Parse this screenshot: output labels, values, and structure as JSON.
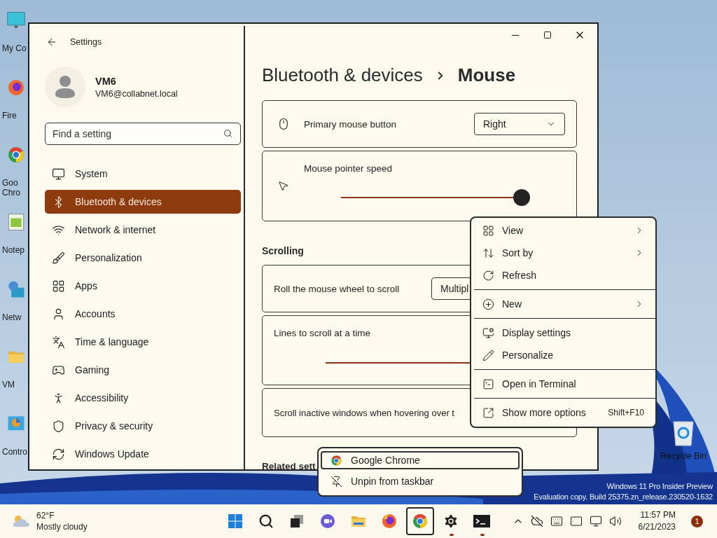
{
  "desktop": {
    "icons": [
      {
        "lines": [
          "My Co"
        ]
      },
      {
        "lines": [
          "Fire"
        ]
      },
      {
        "lines": [
          "Goo",
          "Chro"
        ]
      },
      {
        "lines": [
          "Notep"
        ]
      },
      {
        "lines": [
          "Netw"
        ]
      },
      {
        "lines": [
          "VM"
        ]
      },
      {
        "lines": [
          "Contro"
        ]
      }
    ],
    "recycle_bin": "Recycle Bin",
    "watermark": [
      "Windows 11 Pro Insider Preview",
      "Evaluation copy. Build 25375.zn_release.230520-1632"
    ]
  },
  "settings": {
    "title": "Settings",
    "user": {
      "name": "VM6",
      "email": "VM6@collabnet.local"
    },
    "search": {
      "placeholder": "Find a setting"
    },
    "nav": [
      {
        "label": "System",
        "selected": false
      },
      {
        "label": "Bluetooth & devices",
        "selected": true
      },
      {
        "label": "Network & internet",
        "selected": false
      },
      {
        "label": "Personalization",
        "selected": false
      },
      {
        "label": "Apps",
        "selected": false
      },
      {
        "label": "Accounts",
        "selected": false
      },
      {
        "label": "Time & language",
        "selected": false
      },
      {
        "label": "Gaming",
        "selected": false
      },
      {
        "label": "Accessibility",
        "selected": false
      },
      {
        "label": "Privacy & security",
        "selected": false
      },
      {
        "label": "Windows Update",
        "selected": false
      }
    ],
    "breadcrumb": [
      "Bluetooth & devices",
      "Mouse"
    ],
    "cards": [
      {
        "kind": "dropdown",
        "label": "Primary mouse button",
        "value": "Right",
        "caret": true
      },
      {
        "kind": "slider",
        "label": "Mouse pointer speed",
        "level": 1
      },
      {
        "kind": "heading",
        "label": "Scrolling"
      },
      {
        "kind": "dropdown",
        "label": "Roll the mouse wheel to scroll",
        "value": "Multipl",
        "caret": false
      },
      {
        "kind": "track",
        "label": "Lines to scroll at a time"
      },
      {
        "kind": "text",
        "label": "Scroll inactive windows when hovering over t"
      },
      {
        "kind": "heading",
        "label": "Related sett"
      }
    ]
  },
  "context_menu": [
    {
      "kind": "item",
      "label": "View",
      "submenu": true
    },
    {
      "kind": "item",
      "label": "Sort by",
      "submenu": true
    },
    {
      "kind": "item",
      "label": "Refresh",
      "submenu": false
    },
    {
      "kind": "separator"
    },
    {
      "kind": "item",
      "label": "New",
      "submenu": true
    },
    {
      "kind": "separator"
    },
    {
      "kind": "item",
      "label": "Display settings",
      "submenu": false
    },
    {
      "kind": "item",
      "label": "Personalize",
      "submenu": false
    },
    {
      "kind": "separator"
    },
    {
      "kind": "item",
      "label": "Open in Terminal",
      "submenu": false
    },
    {
      "kind": "separator"
    },
    {
      "kind": "item",
      "label": "Show more options",
      "submenu": false,
      "shortcut": "Shift+F10"
    }
  ],
  "taskbar_menu": [
    {
      "label": "Google Chrome",
      "selected": true
    },
    {
      "label": "Unpin from taskbar",
      "selected": false
    }
  ],
  "taskbar": {
    "weather": {
      "temperature": "62°F",
      "condition": "Mostly cloudy"
    },
    "apps": [
      {
        "selected": false,
        "running": false
      },
      {
        "selected": false,
        "running": false
      },
      {
        "selected": false,
        "running": false
      },
      {
        "selected": false,
        "running": false
      },
      {
        "selected": false,
        "running": false
      },
      {
        "selected": false,
        "running": false
      },
      {
        "selected": true,
        "running": false
      },
      {
        "selected": false,
        "running": true
      },
      {
        "selected": false,
        "running": true
      }
    ],
    "clock": {
      "time": "11:57 PM",
      "date": "6/21/2023"
    },
    "notifications": "1"
  }
}
